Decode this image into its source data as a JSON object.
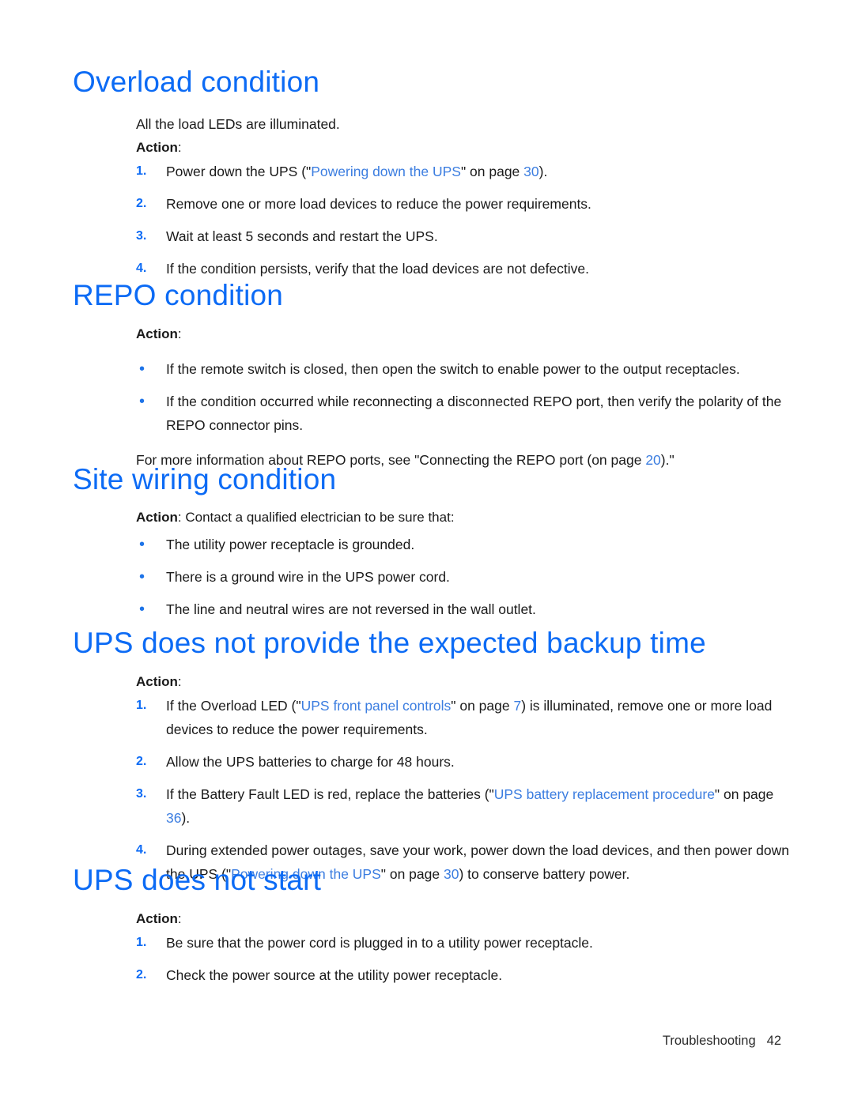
{
  "page": {
    "footer_label": "Troubleshooting",
    "footer_page_number": "42",
    "heading_color": "#0c6bf5",
    "link_color": "#3b7de0",
    "bullet_color": "#1e74e8",
    "body_color": "#1a1a1a"
  },
  "sections": [
    {
      "heading": "Overload condition",
      "intro": "All the load LEDs are illuminated.",
      "action_label": "Action",
      "action_colon": ":",
      "items": [
        {
          "number": "1.",
          "parts": [
            {
              "text": "Power down the UPS (\"",
              "style": "plain"
            },
            {
              "text": "Powering down the UPS",
              "style": "link"
            },
            {
              "text": "\" on page ",
              "style": "plain"
            },
            {
              "text": "30",
              "style": "link"
            },
            {
              "text": ").",
              "style": "plain"
            }
          ]
        },
        {
          "number": "2.",
          "parts": [
            {
              "text": "Remove one or more load devices to reduce the power requirements.",
              "style": "plain"
            }
          ]
        },
        {
          "number": "3.",
          "parts": [
            {
              "text": "Wait at least 5 seconds and restart the UPS.",
              "style": "plain"
            }
          ]
        },
        {
          "number": "4.",
          "parts": [
            {
              "text": "If the condition persists, verify that the load devices are not defective.",
              "style": "plain"
            }
          ]
        }
      ]
    },
    {
      "heading": "REPO condition",
      "action_label": "Action",
      "action_colon": ":",
      "bullets": [
        {
          "parts": [
            {
              "text": "If the remote switch is closed, then open the switch to enable power to the output receptacles.",
              "style": "plain"
            }
          ]
        },
        {
          "parts": [
            {
              "text": "If the condition occurred while reconnecting a disconnected REPO port, then verify the polarity of the REPO connector pins.",
              "style": "plain"
            }
          ]
        }
      ],
      "closing": [
        {
          "text": "For more information about REPO ports, see \"Connecting the REPO port (on page ",
          "style": "plain"
        },
        {
          "text": "20",
          "style": "link"
        },
        {
          "text": ").\"",
          "style": "plain"
        }
      ]
    },
    {
      "heading": "Site wiring condition",
      "action_label": "Action",
      "action_colon": ": Contact a qualified electrician to be sure that:",
      "bullets": [
        {
          "parts": [
            {
              "text": "The utility power receptacle is grounded.",
              "style": "plain"
            }
          ]
        },
        {
          "parts": [
            {
              "text": "There is a ground wire in the UPS power cord.",
              "style": "plain"
            }
          ]
        },
        {
          "parts": [
            {
              "text": "The line and neutral wires are not reversed in the wall outlet.",
              "style": "plain"
            }
          ]
        }
      ]
    },
    {
      "heading": "UPS does not provide the expected backup time",
      "action_label": "Action",
      "action_colon": ":",
      "items": [
        {
          "number": "1.",
          "parts": [
            {
              "text": "If the Overload LED (\"",
              "style": "plain"
            },
            {
              "text": "UPS front panel controls",
              "style": "link"
            },
            {
              "text": "\" on page ",
              "style": "plain"
            },
            {
              "text": "7",
              "style": "link"
            },
            {
              "text": ") is illuminated, remove one or more load devices to reduce the power requirements.",
              "style": "plain"
            }
          ]
        },
        {
          "number": "2.",
          "parts": [
            {
              "text": "Allow the UPS batteries to charge for 48 hours.",
              "style": "plain"
            }
          ]
        },
        {
          "number": "3.",
          "parts": [
            {
              "text": "If the Battery Fault LED is red, replace the batteries (\"",
              "style": "plain"
            },
            {
              "text": "UPS battery replacement procedure",
              "style": "link"
            },
            {
              "text": "\" on page ",
              "style": "plain"
            },
            {
              "text": "36",
              "style": "link"
            },
            {
              "text": ").",
              "style": "plain"
            }
          ]
        },
        {
          "number": "4.",
          "parts": [
            {
              "text": "During extended power outages, save your work, power down the load devices, and then power down the UPS (\"",
              "style": "plain"
            },
            {
              "text": "Powering down the UPS",
              "style": "link"
            },
            {
              "text": "\" on page ",
              "style": "plain"
            },
            {
              "text": "30",
              "style": "link"
            },
            {
              "text": ") to conserve battery power.",
              "style": "plain"
            }
          ]
        }
      ]
    },
    {
      "heading": "UPS does not start",
      "action_label": "Action",
      "action_colon": ":",
      "items": [
        {
          "number": "1.",
          "parts": [
            {
              "text": "Be sure that the power cord is plugged in to a utility power receptacle.",
              "style": "plain"
            }
          ]
        },
        {
          "number": "2.",
          "parts": [
            {
              "text": "Check the power source at the utility power receptacle.",
              "style": "plain"
            }
          ]
        }
      ]
    }
  ]
}
